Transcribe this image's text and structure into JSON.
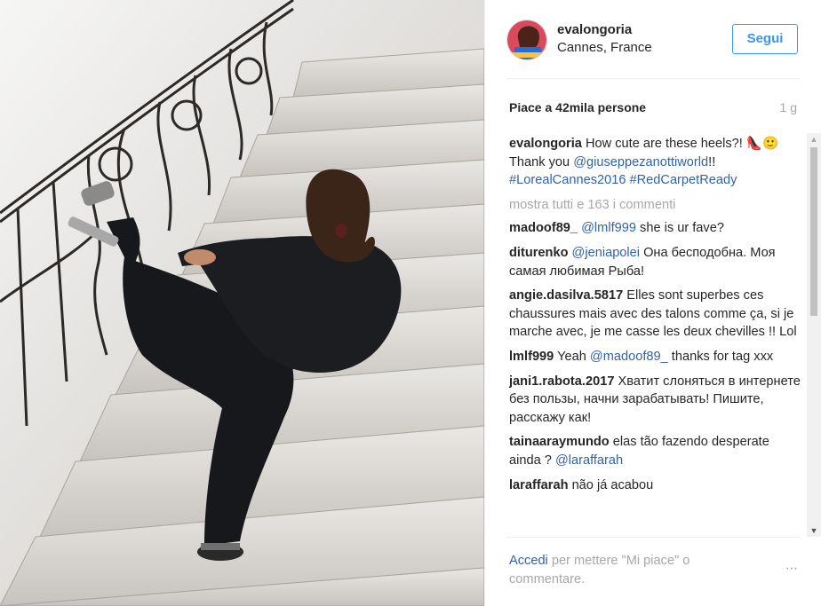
{
  "post": {
    "username": "evalongoria",
    "location": "Cannes, France",
    "follow_label": "Segui",
    "likes": "Piace a 42mila persone",
    "time_ago": "1 g"
  },
  "caption": {
    "user": "evalongoria",
    "text_1": "How cute are these heels?! 👠🙂 Thank you ",
    "link_1": "@giuseppezanottiworld",
    "text_2": "!! ",
    "link_2": "#LorealCannes2016",
    "text_3": " ",
    "link_3": "#RedCarpetReady"
  },
  "show_all_comments": "mostra tutti e 163 i commenti",
  "comments": [
    {
      "user": "madoof89_",
      "link": "@lmlf999",
      "text": " she is ur fave?"
    },
    {
      "user": "diturenko",
      "link": "@jeniapolei",
      "text": " Она бесподобна. Моя самая любимая Рыба!"
    },
    {
      "user": "angie.dasilva.5817",
      "link": "",
      "text": " Elles sont superbes ces chaussures mais avec des talons comme ça, si je marche avec, je me casse les deux chevilles !! Lol"
    },
    {
      "user": "lmlf999",
      "text_pre": " Yeah ",
      "link": "@madoof89_",
      "text": " thanks for tag xxx"
    },
    {
      "user": "jani1.rabota.2017",
      "link": "",
      "text": " Хватит слоняться в интернете без пользы, начни зарабатывать! Пишите, расскажу как!"
    },
    {
      "user": "tainaaraymundo",
      "text_pre": " elas tão fazendo desperate ainda ? ",
      "link": "@laraffarah",
      "text": ""
    },
    {
      "user": "laraffarah",
      "link": "",
      "text": " não já acabou"
    }
  ],
  "footer": {
    "login_label": "Accedi",
    "login_text": " per mettere \"Mi piace\" o commentare.",
    "more_icon": "⋯"
  },
  "colors": {
    "accent": "#3897f0",
    "link": "#3363a3",
    "muted": "#a5a7aa"
  }
}
